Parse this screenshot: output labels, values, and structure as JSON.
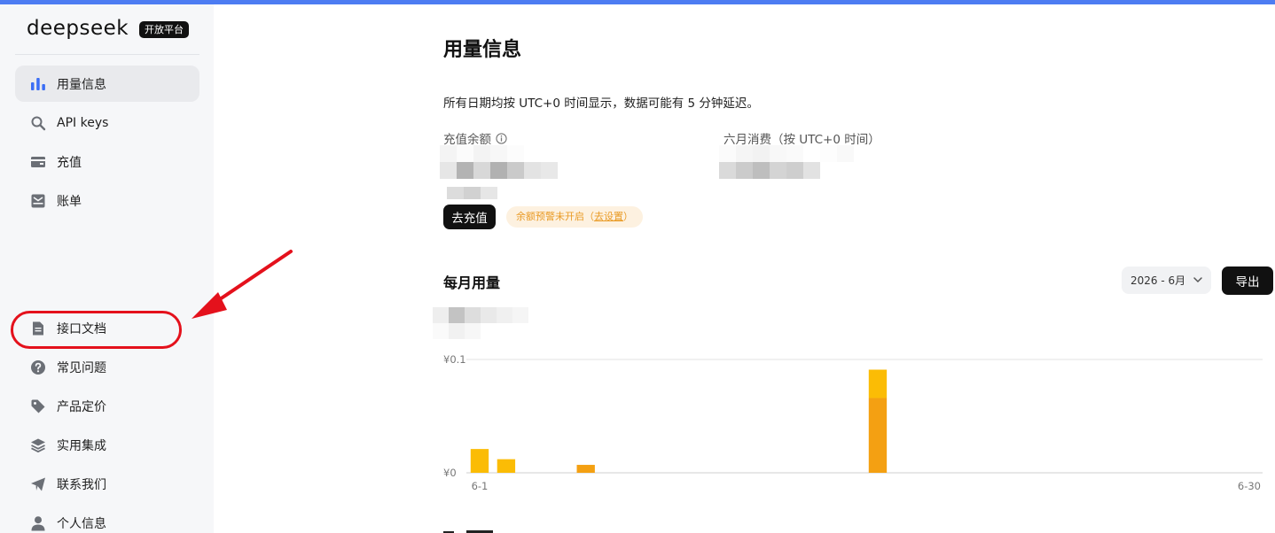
{
  "brand": {
    "logo_text": "deepseek",
    "badge": "开放平台"
  },
  "sidebar": {
    "items": [
      {
        "label": "用量信息",
        "icon": "bar-chart-icon",
        "active": true
      },
      {
        "label": "API keys",
        "icon": "search-key-icon"
      },
      {
        "label": "充值",
        "icon": "wallet-card-icon"
      },
      {
        "label": "账单",
        "icon": "bill-inbox-icon"
      },
      {
        "label": "接口文档",
        "icon": "document-icon"
      },
      {
        "label": "常见问题",
        "icon": "question-icon"
      },
      {
        "label": "产品定价",
        "icon": "price-tag-icon"
      },
      {
        "label": "实用集成",
        "icon": "layers-icon"
      },
      {
        "label": "联系我们",
        "icon": "send-icon"
      },
      {
        "label": "个人信息",
        "icon": "user-icon"
      }
    ],
    "highlighted_item": "接口文档"
  },
  "main": {
    "title": "用量信息",
    "note": "所有日期均按 UTC+0 时间显示，数据可能有 5 分钟延迟。",
    "balance": {
      "label": "充值余额",
      "icon": "info-icon"
    },
    "monthly_spend": {
      "label": "六月消费（按 UTC+0 时间）"
    },
    "recharge_button": "去充值",
    "alert_pill": {
      "text": "余额预警未开启（",
      "link": "去设置",
      "suffix": "）"
    },
    "monthly_usage": {
      "title": "每月用量",
      "month_select": "2026 - 6月",
      "export_button": "导出"
    }
  },
  "colors": {
    "accent_bar": "#4d7cf2",
    "sidebar_bg": "#f6f7f9",
    "bar_primary": "#fbbc05",
    "bar_secondary": "#f4a012",
    "alert_text": "#e99a24",
    "alert_bg": "#fdf1e0",
    "callout_red": "#e4111c"
  },
  "chart_data": {
    "type": "bar",
    "stacked": true,
    "x_range": [
      1,
      30
    ],
    "x_tick_labels": [
      "6-1",
      "6-30"
    ],
    "y_tick_labels": [
      "¥0",
      "¥0.1"
    ],
    "ylim": [
      0,
      0.1
    ],
    "grid": true,
    "bars": [
      {
        "day": 1,
        "segments": [
          0.021
        ]
      },
      {
        "day": 2,
        "segments": [
          0.012
        ]
      },
      {
        "day": 5,
        "segments": [
          0.007
        ]
      },
      {
        "day": 16,
        "segments": [
          0.066,
          0.025
        ]
      }
    ]
  }
}
